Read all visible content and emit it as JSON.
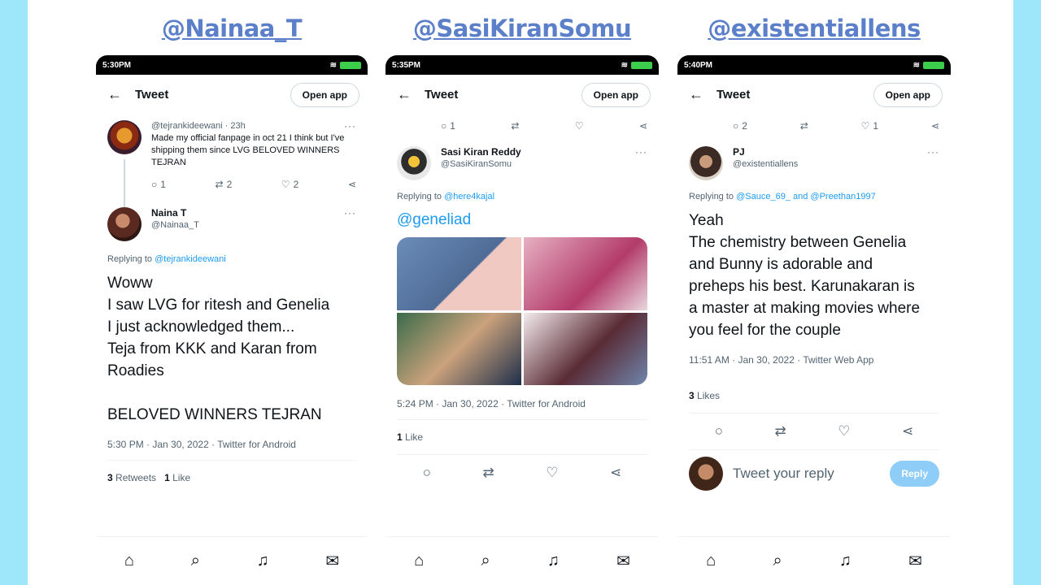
{
  "columns": [
    {
      "handle": "@Nainaa_T",
      "status_time": "5:30PM",
      "topbar": {
        "title": "Tweet",
        "open_app": "Open app"
      },
      "parent": {
        "handle": "@tejrankideewani",
        "time": "23h",
        "text": "Made my official fanpage in oct 21 I think but I've shipping them since LVG BELOVED WINNERS TEJRAN",
        "replies": "1",
        "retweets": "2",
        "likes": "2"
      },
      "tweet": {
        "name": "Naina T",
        "username": "@Nainaa_T",
        "replying_prefix": "Replying to",
        "replying_to": "@tejrankideewani",
        "text_lines": [
          "Woww",
          "I saw LVG for ritesh and Genelia",
          "I just acknowledged them...",
          "Teja from KKK and Karan from",
          "Roadies",
          "",
          "BELOVED WINNERS TEJRAN"
        ],
        "timestamp": "5:30 PM · Jan 30, 2022 · Twitter for Android",
        "retweets_count": "3",
        "retweets_label": "Retweets",
        "likes_count": "1",
        "likes_label": "Like"
      }
    },
    {
      "handle": "@SasiKiranSomu",
      "status_time": "5:35PM",
      "topbar": {
        "title": "Tweet",
        "open_app": "Open app"
      },
      "parent": {
        "replies": "1",
        "retweets": "",
        "likes": ""
      },
      "tweet": {
        "name": "Sasi Kiran Reddy",
        "username": "@SasiKiranSomu",
        "replying_prefix": "Replying to",
        "replying_to": "@here4kajal",
        "mention": "@geneliad",
        "timestamp": "5:24 PM · Jan 30, 2022 · Twitter for Android",
        "likes_count": "1",
        "likes_label": "Like"
      }
    },
    {
      "handle": "@existentiallens",
      "status_time": "5:40PM",
      "topbar": {
        "title": "Tweet",
        "open_app": "Open app"
      },
      "parent": {
        "replies": "2",
        "retweets": "",
        "likes": "1"
      },
      "tweet": {
        "name": "PJ",
        "username": "@existentiallens",
        "replying_prefix": "Replying to",
        "replying_to": "@Sauce_69_ and @Preethan1997",
        "text_lines": [
          "Yeah",
          "The chemistry between Genelia",
          "and Bunny is adorable and",
          "preheps his best. Karunakaran is",
          "a master at making movies where",
          "you feel for the couple"
        ],
        "timestamp": "11:51 AM · Jan 30, 2022 · Twitter Web App",
        "likes_count": "3",
        "likes_label": "Likes"
      },
      "reply_bar": {
        "placeholder": "Tweet your reply",
        "button": "Reply"
      }
    }
  ],
  "colors": {
    "accent": "#1d9bf0",
    "handle_title": "#5b7fc9",
    "frame": "#9ee7fb"
  },
  "icons": [
    "back-arrow-icon",
    "reply-icon",
    "retweet-icon",
    "like-icon",
    "share-icon",
    "home-icon",
    "search-icon",
    "bell-icon",
    "mail-icon",
    "more-icon"
  ]
}
